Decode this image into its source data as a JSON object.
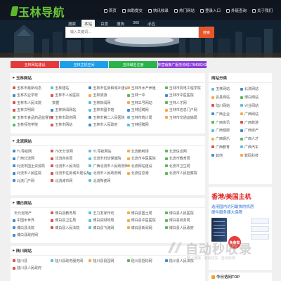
{
  "header": {
    "logo_text": "玉林导航",
    "nav": [
      {
        "label": "首页",
        "icon": "home-icon"
      },
      {
        "label": "自助提交",
        "icon": "submit-icon"
      },
      {
        "label": "快讯收录",
        "icon": "bolt-icon"
      },
      {
        "label": "热门网站",
        "icon": "hot-icon"
      },
      {
        "label": "登录入口",
        "icon": "login-icon"
      },
      {
        "label": "外链查询",
        "icon": "link-icon"
      },
      {
        "label": "关于我们",
        "icon": "about-icon"
      }
    ]
  },
  "search": {
    "tabs": [
      "搜索",
      "本站",
      "百度",
      "搜狗",
      "360",
      "必应"
    ],
    "active_tab": "本站",
    "placeholder": "输入关键词...",
    "button_label": "搜索"
  },
  "banners": [
    {
      "label": "玉林网站建设",
      "color": "#e23b3b"
    },
    {
      "label": "玉林主机空间",
      "color": "#1e9ee8"
    },
    {
      "label": "玉林域名注册",
      "color": "#29b34a"
    },
    {
      "label": "玉林营销推广服务热线17840824369",
      "color": "#8b3fd9"
    }
  ],
  "sections": [
    {
      "title": "玉林网站",
      "links": [
        {
          "t": "玉林市最新动态",
          "c": "#d9534f"
        },
        {
          "t": "玉林建站",
          "c": "#5bc0de"
        },
        {
          "t": "玉林市住房和城乡建设局",
          "c": "#3a87ad"
        },
        {
          "t": "玉林市水产养殖",
          "c": "#f0ad4e"
        },
        {
          "t": "玉林市机电工程学院",
          "c": "#5cb85c"
        },
        {
          "t": "玉林农业学校",
          "c": "#428bca"
        },
        {
          "t": "玉林市人民医院",
          "c": "#d9534f"
        },
        {
          "t": "玉林旅游",
          "c": "#f0ad4e"
        },
        {
          "t": "玉林一中",
          "c": "#5cb85c"
        },
        {
          "t": "玉林市中医医院",
          "c": "#428bca"
        },
        {
          "t": "玉林市人民法院",
          "c": "#d9534f"
        },
        {
          "t": "数据",
          "c": ""
        },
        {
          "t": "玉林新闻网",
          "c": "#5bc0de"
        },
        {
          "t": "玉林11号网站",
          "c": "#f0ad4e"
        },
        {
          "t": "玉林人才网",
          "c": "#5cb85c"
        },
        {
          "t": "玉林文明网",
          "c": "#d9534f"
        },
        {
          "t": "玉林新闻网站",
          "c": "#428bca"
        },
        {
          "t": "玉林市图书馆",
          "c": "#5bc0de"
        },
        {
          "t": "玉林招聘网",
          "c": "#428bca"
        },
        {
          "t": "玉林市信息门户网",
          "c": "#f0ad4e"
        },
        {
          "t": "玉林市食品药品监督管理局",
          "c": "#5cb85c"
        },
        {
          "t": "玉林市政府网",
          "c": "#d9534f"
        },
        {
          "t": "玉林市第二人民医院",
          "c": "#428bca"
        },
        {
          "t": "玉林市统计局",
          "c": "#5bc0de"
        },
        {
          "t": "玉林市交通运输局",
          "c": "#f0ad4e"
        },
        {
          "t": "玉林师范学院",
          "c": "#5cb85c"
        },
        {
          "t": "玉林市网站",
          "c": "#d9534f"
        },
        {
          "t": "玉林市人民政府",
          "c": "#428bca"
        },
        {
          "t": "玉林招聘网",
          "c": "#5bc0de"
        }
      ]
    },
    {
      "title": "北流网站",
      "links": [
        {
          "t": "YL导航网",
          "c": "#428bca"
        },
        {
          "t": "76天分享网",
          "c": "#d9534f"
        },
        {
          "t": "YL导航网站",
          "c": "#5bc0de"
        },
        {
          "t": "北流鹅鸭场",
          "c": "#f0ad4e"
        },
        {
          "t": "北流信息网",
          "c": "#5cb85c"
        },
        {
          "t": "广西北流网",
          "c": "#428bca"
        },
        {
          "t": "北流商务局",
          "c": "#d9534f"
        },
        {
          "t": "北流市妇幼保健院",
          "c": "#5bc0de"
        },
        {
          "t": "北流市中医医院",
          "c": "#f0ad4e"
        },
        {
          "t": "北流市教育局",
          "c": "#5cb85c"
        },
        {
          "t": "北流市国土资源局",
          "c": "#428bca"
        },
        {
          "t": "北流市人民法院",
          "c": "#d9534f"
        },
        {
          "t": "广西北流市人民政府网",
          "c": "#5bc0de"
        },
        {
          "t": "北流网站建设",
          "c": "#f0ad4e"
        },
        {
          "t": "北流市卫生局",
          "c": "#5cb85c"
        },
        {
          "t": "北流市人民医院",
          "c": "#428bca"
        },
        {
          "t": "北流市住房城乡建设局",
          "c": "#d9534f"
        },
        {
          "t": "北流市人民政府网",
          "c": "#5bc0de"
        },
        {
          "t": "北流信息港",
          "c": "#f0ad4e"
        },
        {
          "t": "北流市人民检察院",
          "c": "#5cb85c"
        },
        {
          "t": "北流门户网",
          "c": "#428bca"
        },
        {
          "t": "北流城市网",
          "c": "#d9534f"
        },
        {
          "t": "北流陶瓷网",
          "c": "#5bc0de"
        }
      ]
    },
    {
      "title": "博白网站",
      "links": [
        {
          "t": "天元泡地产",
          "c": ""
        },
        {
          "t": "博白县教育局",
          "c": "#d9534f"
        },
        {
          "t": "王力发家作坊",
          "c": "#5bc0de"
        },
        {
          "t": "博白县国土局",
          "c": "#f0ad4e"
        },
        {
          "t": "博白县人民医院",
          "c": "#5cb85c"
        },
        {
          "t": "中国水世界",
          "c": "#428bca"
        },
        {
          "t": "博白县卫生局",
          "c": "#d9534f"
        },
        {
          "t": "博白县财政局",
          "c": "#5bc0de"
        },
        {
          "t": "博白县中医医院",
          "c": "#f0ad4e"
        },
        {
          "t": "博白县商务局",
          "c": "#5cb85c"
        },
        {
          "t": "博白县法院",
          "c": "#428bca"
        },
        {
          "t": "博白县人民法院",
          "c": "#d9534f"
        },
        {
          "t": "博白县飞驰网",
          "c": "#5bc0de"
        },
        {
          "t": "博白县新闻网",
          "c": "#f0ad4e"
        },
        {
          "t": "博白县人民政府",
          "c": "#5cb85c"
        },
        {
          "t": "博白县政府网",
          "c": "#428bca"
        }
      ]
    },
    {
      "title": "陆川网站",
      "links": [
        {
          "t": "陆川县",
          "c": "#d9534f"
        },
        {
          "t": "陆川县政务服务网",
          "c": "#5bc0de"
        },
        {
          "t": "陆川县县园网",
          "c": "#f0ad4e"
        },
        {
          "t": "陆川县招标网",
          "c": "#5cb85c"
        },
        {
          "t": "陆川县人民法院",
          "c": "#428bca"
        },
        {
          "t": "陆川县人民政府",
          "c": "#d9534f"
        }
      ]
    }
  ],
  "sidebar": {
    "title": "网站分类",
    "items": [
      {
        "t": "玉林网站",
        "c": "#5bc0de"
      },
      {
        "t": "北流网站",
        "c": "#428bca"
      },
      {
        "t": "容县网站",
        "c": "#f0ad4e"
      },
      {
        "t": "博白网站",
        "c": "#5cb85c"
      },
      {
        "t": "陆川网站",
        "c": "#d9534f"
      },
      {
        "t": "兴业网站",
        "c": "#5bc0de"
      },
      {
        "t": "广西企业",
        "c": "#428bca"
      },
      {
        "t": "广西网站",
        "c": "#f0ad4e"
      },
      {
        "t": "广西资讯",
        "c": "#5cb85c"
      },
      {
        "t": "广西旅游",
        "c": "#d9534f"
      },
      {
        "t": "广西健康",
        "c": "#5bc0de"
      },
      {
        "t": "广西房产",
        "c": "#428bca"
      },
      {
        "t": "广西娱乐",
        "c": "#f0ad4e"
      },
      {
        "t": "广西人才",
        "c": "#5cb85c"
      },
      {
        "t": "广西教育",
        "c": "#d9534f"
      },
      {
        "t": "广西汽车",
        "c": "#5bc0de"
      },
      {
        "t": "其他",
        "c": "#428bca"
      },
      {
        "t": "数码科技",
        "c": "#f0ad4e"
      }
    ]
  },
  "ad": {
    "title": "香港/美国主机",
    "line1": "选用国内访问最快的机房",
    "line2": "硬件服务器大保障",
    "badge": "免备案"
  },
  "today": {
    "title": "今日访问TOP"
  },
  "watermark": {
    "main": "自动秒收录",
    "sub": "数上链接 · 来访优先 · 自动收录"
  }
}
